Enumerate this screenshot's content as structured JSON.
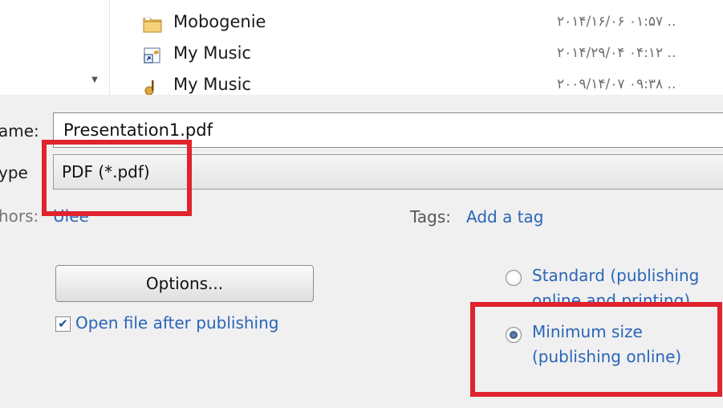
{
  "files": [
    {
      "name": "Mobogenie",
      "date": "۲۰۱۴/۱۶/۰۶ ۰۱:۵۷ ..",
      "icon": "folder-icon"
    },
    {
      "name": "My Music",
      "date": "۲۰۱۴/۲۹/۰۴ ۰۴:۱۲ ..",
      "icon": "shortcut-icon"
    },
    {
      "name": "My Music",
      "date": "۲۰۰۹/۱۴/۰۷ ۰۹:۳۸ ..",
      "icon": "music-folder-icon"
    }
  ],
  "form": {
    "filename_label": "ame:",
    "filename_value": "Presentation1.pdf",
    "type_label": "ype",
    "type_value": "PDF (*.pdf)",
    "authors_label": "hors:",
    "authors_value": "Ulee",
    "tags_label": "Tags:",
    "tags_value": "Add a tag",
    "options_label": "Options...",
    "open_after_label": "Open file after publishing",
    "open_after_checked": true,
    "optimize": {
      "standard_line1": "Standard (publishing",
      "standard_line2": "online and printing)",
      "minimum_line1": "Minimum size",
      "minimum_line2": "(publishing online)",
      "selected": "minimum"
    }
  },
  "colors": {
    "link": "#2a65b8",
    "highlight": "#e0232d",
    "panel": "#f0f0f0"
  }
}
